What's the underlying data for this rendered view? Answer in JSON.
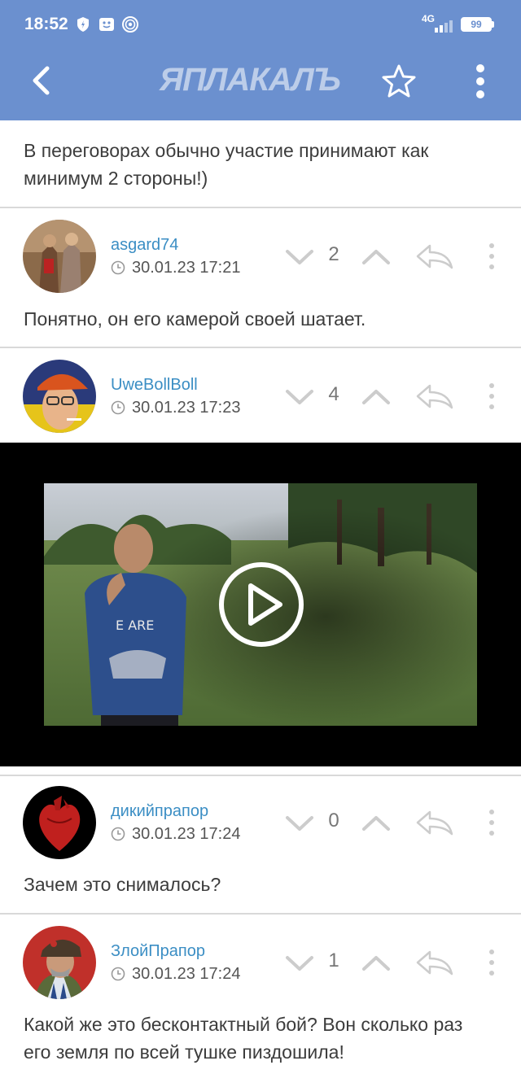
{
  "status": {
    "time": "18:52",
    "network": "4G",
    "battery": "99"
  },
  "header": {
    "logo": "ЯПЛАКАЛЪ"
  },
  "post_tail": "В переговорах обычно участие принимают как минимум 2 стороны!)",
  "comments": [
    {
      "user": "asgard74",
      "date": "30.01.23 17:21",
      "votes": "2",
      "text": "Понятно, он его камерой своей шатает."
    },
    {
      "user": "UweBollBoll",
      "date": "30.01.23 17:23",
      "votes": "4",
      "text": ""
    },
    {
      "user": "дикийпрапор",
      "date": "30.01.23 17:24",
      "votes": "0",
      "text": "Зачем это снималось?"
    },
    {
      "user": "ЗлойПрапор",
      "date": "30.01.23 17:24",
      "votes": "1",
      "text": "Какой же это бесконтактный бой? Вон сколько раз его земля по всей тушке пиздошила!"
    }
  ],
  "colors": {
    "header_bg": "#6b90cf",
    "username": "#3b8ec4",
    "divider": "#d9d9d9"
  }
}
